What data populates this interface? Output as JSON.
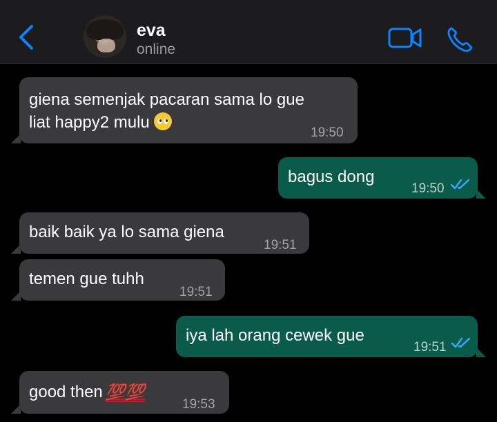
{
  "header": {
    "contact_name": "eva",
    "status": "online",
    "accent_color": "#0a84ff"
  },
  "messages": [
    {
      "direction": "incoming",
      "lines": [
        "giena semenjak pacaran sama lo gue",
        "liat happy2 mulu"
      ],
      "emoji": "pleading-face",
      "time": "19:50"
    },
    {
      "direction": "outgoing",
      "text": "bagus dong",
      "time": "19:50",
      "status": "read"
    },
    {
      "direction": "incoming",
      "text": "baik baik ya lo sama giena",
      "time": "19:51"
    },
    {
      "direction": "incoming",
      "text": "temen gue tuhh",
      "time": "19:51"
    },
    {
      "direction": "outgoing",
      "text": "iya lah orang cewek gue",
      "time": "19:51",
      "status": "read"
    },
    {
      "direction": "incoming",
      "text": "good then",
      "emoji": "hundred-points x2",
      "emoji_text": "💯💯",
      "time": "19:53"
    }
  ]
}
